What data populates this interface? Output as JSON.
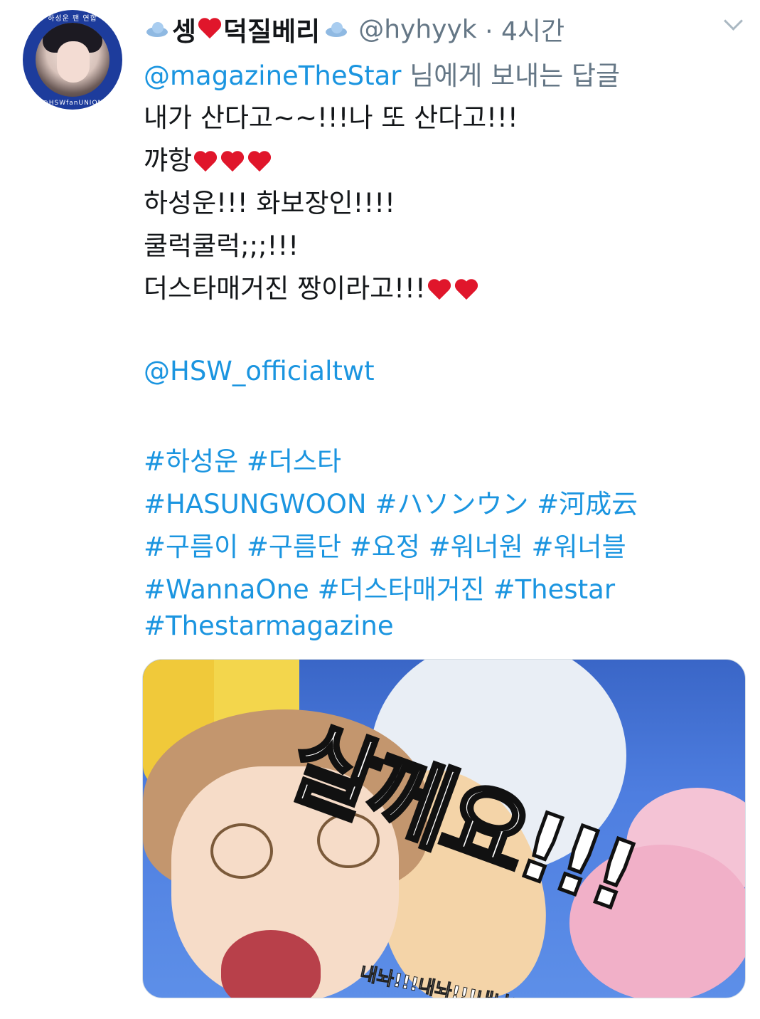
{
  "tweet": {
    "avatar": {
      "ring_top_text": "하성운 팬 연합",
      "ring_bottom_text": "@HSWfanUNION"
    },
    "header": {
      "name_part1": "셍",
      "name_part2": "덕질베리",
      "handle": "@hyhyyk",
      "time": " · 4시간"
    },
    "reply": {
      "mention": "@magazineTheStar",
      "suffix": " 님에게 보내는 답글"
    },
    "body_lines": [
      "내가 산다고~~!!!나 또 산다고!!!",
      "꺄항",
      "하성운!!! 화보장인!!!!",
      "쿨럭쿨럭;;;!!!",
      "더스타매거진 짱이라고!!!"
    ],
    "official_mention": " @HSW_officialtwt",
    "hashtag_lines": [
      " #하성운 #더스타",
      "#HASUNGWOON #ハソンウン #河成云",
      "#구름이 #구름단 #요정 #워너원 #워너블",
      "#WannaOne #더스타매거진 #Thestar",
      "#Thestarmagazine"
    ],
    "media": {
      "big_text": "살께요!!!",
      "small_text": "내놔!!!내놔!!!내놔!!!내놔!!!내놔랏!!!..."
    }
  }
}
